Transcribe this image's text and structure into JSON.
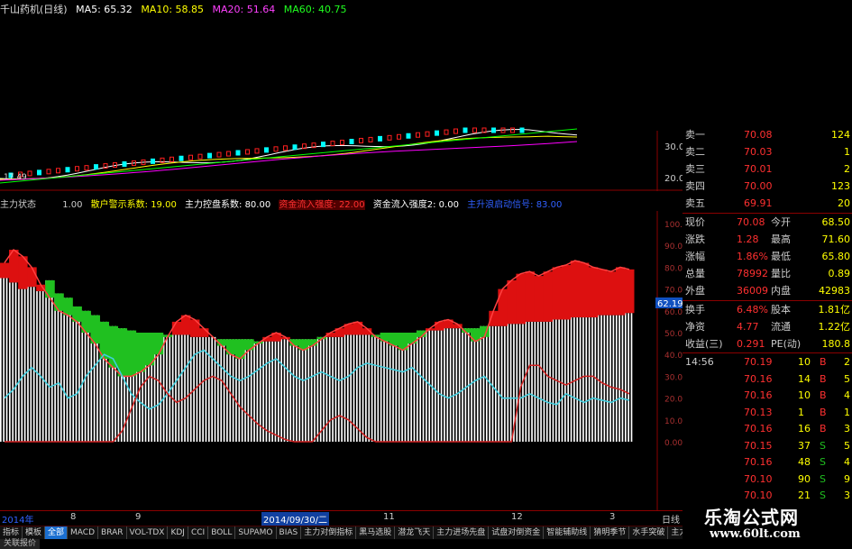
{
  "header": {
    "title": "千山药机(日线)",
    "ma": [
      {
        "label": "MA5: 65.32",
        "color": "#ffffff"
      },
      {
        "label": "MA10: 58.85",
        "color": "#ffff00"
      },
      {
        "label": "MA20: 51.64",
        "color": "#ff00ff"
      },
      {
        "label": "MA60: 40.75",
        "color": "#00ff00"
      }
    ]
  },
  "price_axis": {
    "labels": [
      "30.00",
      "20.00"
    ]
  },
  "price_low_label": "17.49",
  "indicator_header": {
    "name": "主力状态",
    "items": [
      {
        "text": "1.00",
        "color": "#cccccc"
      },
      {
        "text": "散户警示系数: 19.00",
        "color": "#ffff00"
      },
      {
        "text": "主力控盘系数: 80.00",
        "color": "#ffffff"
      },
      {
        "text": "资金流入强度: 22.00",
        "color": "#ff3030",
        "bg": "#600000"
      },
      {
        "text": "资金流入强度2: 0.00",
        "color": "#ffffff"
      },
      {
        "text": "主升浪启动信号: 83.00",
        "color": "#3060ff"
      }
    ]
  },
  "indicator_axis": {
    "labels": [
      "100.00",
      "90.00",
      "80.00",
      "70.00",
      "60.00",
      "50.00",
      "40.00",
      "30.00",
      "20.00",
      "10.00",
      "0.00"
    ]
  },
  "current_marker": "62.19",
  "date_axis": {
    "labels": [
      "2014年",
      "8",
      "9",
      "2014/09/30/二",
      "11",
      "12",
      "3"
    ],
    "end_label": "日线"
  },
  "bottom_tabs": [
    "指标",
    "模板",
    "全部",
    "MACD",
    "BRAR",
    "VOL-TDX",
    "KDJ",
    "CCI",
    "BOLL",
    "SUPAMO",
    "BIAS",
    "主力对倒指标",
    "黑马选股",
    "潜龙飞天",
    "主力进场先盘",
    "试盘对倒资金",
    "智能辅助线",
    "猜明季节",
    "水手突破",
    "主力控盘"
  ],
  "active_tab": "全部",
  "footer_tab": "关联报价",
  "order_book": [
    {
      "label": "卖一",
      "price": "70.08",
      "vol": "124"
    },
    {
      "label": "卖二",
      "price": "70.03",
      "vol": "1"
    },
    {
      "label": "卖三",
      "price": "70.01",
      "vol": "2"
    },
    {
      "label": "卖四",
      "price": "70.00",
      "vol": "123"
    },
    {
      "label": "卖五",
      "price": "69.91",
      "vol": "20"
    }
  ],
  "quote_stats": [
    {
      "l1": "现价",
      "v1": "70.08",
      "l2": "今开",
      "v2": "68.50"
    },
    {
      "l1": "涨跌",
      "v1": "1.28",
      "l2": "最高",
      "v2": "71.60"
    },
    {
      "l1": "涨幅",
      "v1": "1.86%",
      "l2": "最低",
      "v2": "65.80"
    },
    {
      "l1": "总量",
      "v1": "78992",
      "l2": "量比",
      "v2": "0.89"
    },
    {
      "l1": "外盘",
      "v1": "36009",
      "l2": "内盘",
      "v2": "42983"
    }
  ],
  "quote_stats2": [
    {
      "l1": "换手",
      "v1": "6.48%",
      "l2": "股本",
      "v2": "1.81亿"
    },
    {
      "l1": "净资",
      "v1": "4.77",
      "l2": "流通",
      "v2": "1.22亿"
    },
    {
      "l1": "收益(三)",
      "v1": "0.291",
      "l2": "PE(动)",
      "v2": "180.8"
    }
  ],
  "trades": [
    {
      "time": "14:56",
      "price": "70.19",
      "vol": "10",
      "side": "B",
      "n": "2"
    },
    {
      "time": "",
      "price": "70.16",
      "vol": "14",
      "side": "B",
      "n": "5"
    },
    {
      "time": "",
      "price": "70.16",
      "vol": "10",
      "side": "B",
      "n": "4"
    },
    {
      "time": "",
      "price": "70.13",
      "vol": "1",
      "side": "B",
      "n": "1"
    },
    {
      "time": "",
      "price": "70.16",
      "vol": "16",
      "side": "B",
      "n": "3"
    },
    {
      "time": "",
      "price": "70.15",
      "vol": "37",
      "side": "S",
      "n": "5"
    },
    {
      "time": "",
      "price": "70.16",
      "vol": "48",
      "side": "S",
      "n": "4"
    },
    {
      "time": "",
      "price": "70.10",
      "vol": "90",
      "side": "S",
      "n": "9"
    },
    {
      "time": "",
      "price": "70.10",
      "vol": "21",
      "side": "S",
      "n": "3"
    }
  ],
  "watermark": {
    "line1": "乐淘公式网",
    "line2": "www.60lt.com"
  },
  "colors": {
    "up": "#ff2020",
    "down": "#20c020",
    "axis": "#8b0000",
    "ma5": "#ffffff",
    "ma10": "#ffff00",
    "ma20": "#ff00ff",
    "ma60": "#00ff00"
  },
  "chart_data": {
    "type": "bar",
    "title": "主力状态",
    "ylim": [
      0,
      100
    ],
    "x": [
      0,
      1,
      2,
      3,
      4,
      5,
      6,
      7,
      8,
      9,
      10,
      11,
      12,
      13,
      14,
      15,
      16,
      17,
      18,
      19,
      20,
      21,
      22,
      23,
      24,
      25,
      26,
      27,
      28,
      29,
      30,
      31,
      32,
      33,
      34,
      35,
      36,
      37,
      38,
      39,
      40,
      41,
      42,
      43,
      44,
      45,
      46,
      47,
      48,
      49,
      50,
      51,
      52,
      53,
      54,
      55,
      56,
      57,
      58,
      59,
      60,
      61,
      62,
      63,
      64,
      65,
      66,
      67,
      68,
      69
    ],
    "series": [
      {
        "name": "主力控盘系数",
        "type": "bar",
        "values": [
          75,
          73,
          70,
          71,
          69,
          74,
          68,
          66,
          62,
          60,
          58,
          55,
          53,
          52,
          51,
          50,
          50,
          50,
          49,
          49,
          49,
          48,
          48,
          48,
          47,
          47,
          47,
          47,
          46,
          46,
          46,
          47,
          47,
          47,
          47,
          48,
          48,
          48,
          49,
          49,
          49,
          49,
          50,
          50,
          50,
          50,
          51,
          51,
          51,
          52,
          52,
          52,
          52,
          53,
          53,
          53,
          54,
          54,
          55,
          55,
          55,
          56,
          56,
          57,
          57,
          57,
          58,
          58,
          58,
          59
        ]
      },
      {
        "name": "散户警示系数",
        "type": "line",
        "values": [
          20,
          24,
          30,
          34,
          30,
          25,
          27,
          20,
          22,
          30,
          35,
          40,
          38,
          30,
          22,
          18,
          15,
          17,
          22,
          28,
          34,
          40,
          42,
          38,
          34,
          30,
          28,
          30,
          33,
          36,
          38,
          34,
          30,
          28,
          30,
          32,
          30,
          28,
          30,
          34,
          36,
          35,
          34,
          33,
          32,
          34,
          30,
          26,
          22,
          20,
          22,
          25,
          28,
          30,
          25,
          20,
          20,
          20,
          22,
          20,
          18,
          17,
          22,
          20,
          18,
          20,
          19,
          18,
          20,
          19
        ]
      },
      {
        "name": "资金流入强度",
        "type": "line",
        "values": [
          0,
          0,
          0,
          0,
          0,
          0,
          0,
          0,
          0,
          0,
          0,
          0,
          0,
          5,
          15,
          25,
          30,
          28,
          22,
          18,
          20,
          24,
          28,
          30,
          28,
          22,
          16,
          12,
          8,
          5,
          3,
          1,
          0,
          0,
          0,
          5,
          10,
          12,
          10,
          6,
          2,
          0,
          0,
          0,
          0,
          0,
          0,
          0,
          0,
          0,
          0,
          0,
          0,
          0,
          0,
          0,
          0,
          25,
          35,
          35,
          30,
          28,
          26,
          28,
          30,
          30,
          27,
          25,
          24,
          22
        ]
      },
      {
        "name": "主升浪启动信号",
        "type": "line",
        "values": [
          82,
          88,
          85,
          80,
          72,
          66,
          60,
          58,
          55,
          50,
          45,
          38,
          34,
          30,
          30,
          32,
          35,
          40,
          48,
          55,
          58,
          56,
          52,
          48,
          44,
          40,
          38,
          42,
          45,
          48,
          50,
          48,
          44,
          42,
          44,
          47,
          50,
          52,
          54,
          55,
          52,
          48,
          46,
          44,
          42,
          45,
          48,
          52,
          55,
          56,
          54,
          50,
          46,
          48,
          60,
          70,
          74,
          77,
          78,
          76,
          78,
          80,
          81,
          83,
          82,
          80,
          79,
          78,
          80,
          79
        ]
      }
    ]
  }
}
